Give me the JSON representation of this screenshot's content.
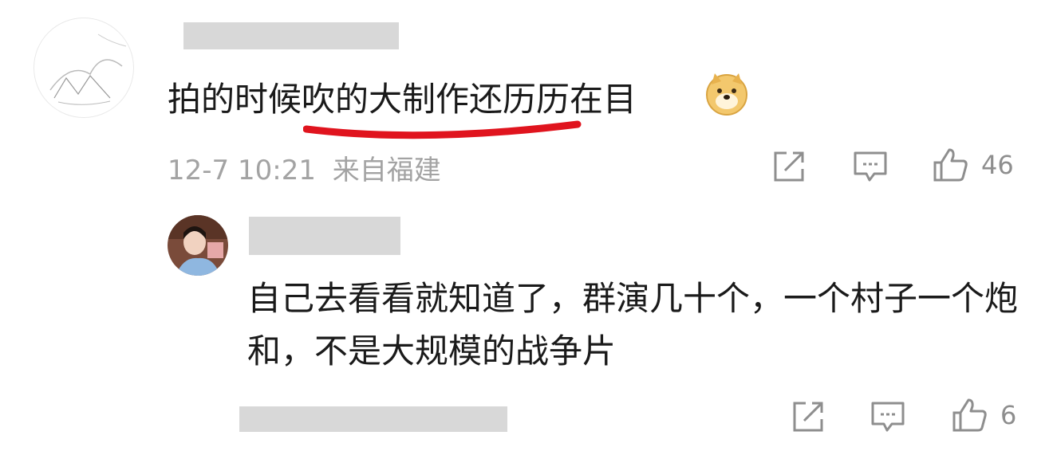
{
  "comment": {
    "username": "",
    "text": "拍的时候吹的大制作还历历在目",
    "emoji": "doge-emoji",
    "timestamp": "12-7 10:21",
    "location": "来自福建",
    "likes": "46",
    "highlight_color": "#e0141e"
  },
  "reply": {
    "username": "",
    "text": "自己去看看就知道了，群演几十个，一个村子一个炮和，不是大规模的战争片",
    "likes": "6"
  },
  "icons": {
    "share": "share-icon",
    "comment": "comment-icon",
    "like": "thumbs-up-icon"
  }
}
